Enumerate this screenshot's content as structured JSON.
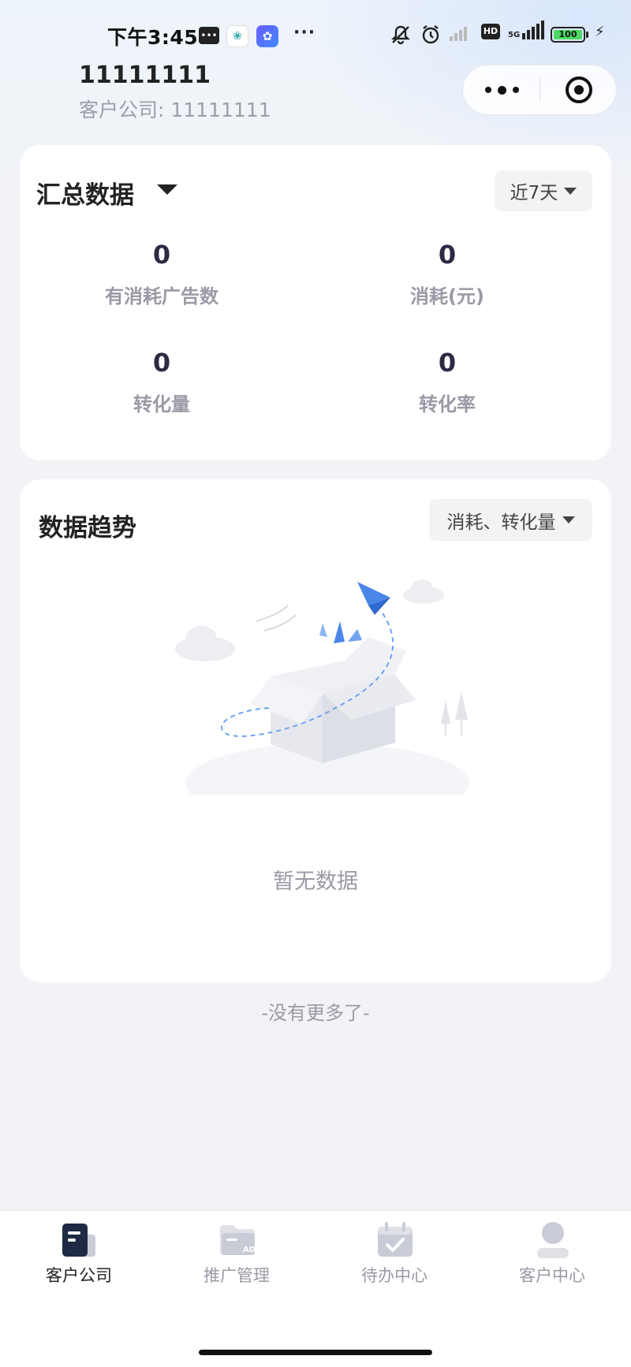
{
  "status_bar": {
    "time": "下午3:45",
    "battery": "100",
    "network": "5G",
    "hd": "HD"
  },
  "header": {
    "title": "11111111",
    "subtitle": "客户公司: 11111111"
  },
  "summary": {
    "title": "汇总数据",
    "range_label": "近7天",
    "stats": [
      {
        "value": "0",
        "label": "有消耗广告数"
      },
      {
        "value": "0",
        "label": "消耗(元)"
      },
      {
        "value": "0",
        "label": "转化量"
      },
      {
        "value": "0",
        "label": "转化率"
      }
    ]
  },
  "trend": {
    "title": "数据趋势",
    "metrics_label": "消耗、转化量",
    "empty_text": "暂无数据"
  },
  "footer_note": "-没有更多了-",
  "tabbar": {
    "active_index": 0,
    "items": [
      {
        "label": "客户公司",
        "icon": "company-icon"
      },
      {
        "label": "推广管理",
        "icon": "ad-folder-icon"
      },
      {
        "label": "待办中心",
        "icon": "todo-calendar-icon"
      },
      {
        "label": "客户中心",
        "icon": "user-icon"
      }
    ]
  },
  "colors": {
    "accent_dark": "#1f2a44",
    "inactive_icon": "#c9ccd6",
    "muted_text": "#9a9aa6",
    "background": "#f2f3f6"
  }
}
